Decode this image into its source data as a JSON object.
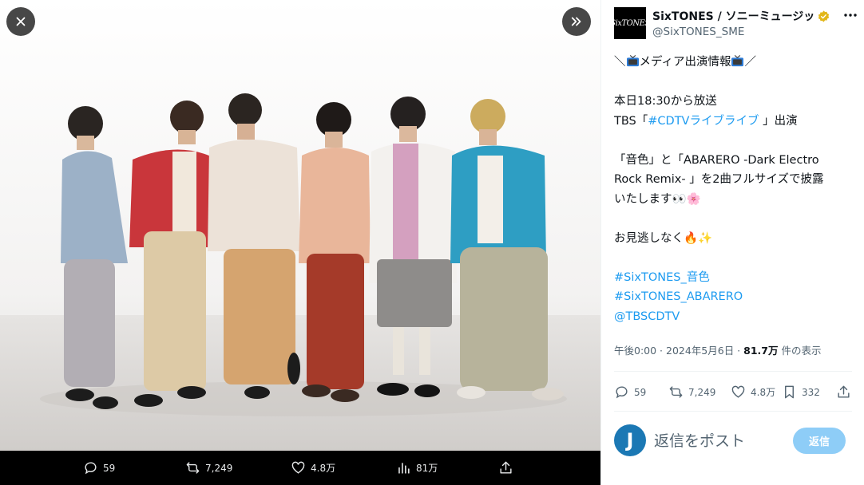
{
  "viewer": {
    "close_icon": "close-icon",
    "next_icon": "chevron-double-right-icon",
    "actions": {
      "replies": "59",
      "reposts": "7,249",
      "likes": "4.8万",
      "views": "81万"
    }
  },
  "post": {
    "avatar_text": "SixTONES",
    "display_name": "SixTONES / ソニーミュージッ",
    "handle": "@SixTONES_SME",
    "lines": {
      "l1_prefix": "＼",
      "l1_text": "メディア出演情報",
      "l1_suffix": "／",
      "l2": "本日18:30から放送",
      "l3_prefix": "TBS「",
      "l3_link": "#CDTVライブライブ",
      "l3_suffix": " 」出演",
      "l4": "「音色」と「ABARERO -Dark Electro",
      "l5": "Rock Remix- 」を2曲フルサイズで披露",
      "l6": "いたします👀🌸",
      "l7": "お見逃しなく🔥✨",
      "tag1": "#SixTONES_音色",
      "tag2": "#SixTONES_ABARERO",
      "tag3": "@TBSCDTV"
    },
    "meta": {
      "time": "午後0:00 · 2024年5月6日 · ",
      "views": "81.7万",
      "views_label": " 件の表示"
    },
    "stats": {
      "replies": "59",
      "reposts": "7,249",
      "likes": "4.8万",
      "bookmarks": "332"
    }
  },
  "reply": {
    "avatar_letter": "J",
    "placeholder": "返信をポスト",
    "button": "返信"
  },
  "colors": {
    "accent": "#1d9bf0",
    "reply_button": "#8ecdf7",
    "verified": "#e2b719"
  }
}
